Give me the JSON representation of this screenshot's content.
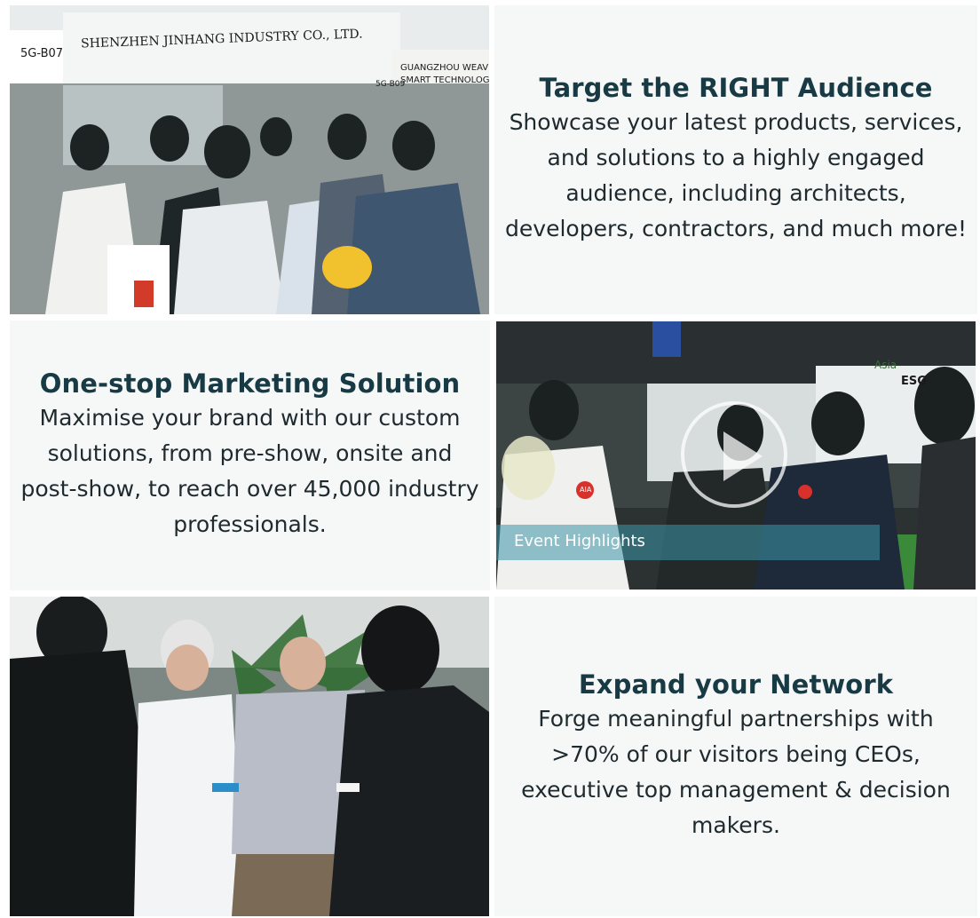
{
  "blocks": [
    {
      "title": "Target the RIGHT Audience",
      "lines": [
        "Showcase your latest products, services,",
        "and solutions to a highly engaged",
        "audience, including architects,",
        "developers, contractors, and much more!"
      ]
    },
    {
      "title": "One-stop Marketing Solution",
      "lines": [
        "Maximise your brand with our custom",
        "solutions, from pre-show, onsite and",
        "post-show, to reach over 45,000 industry",
        "professionals."
      ]
    },
    {
      "title": "Expand your Network",
      "lines": [
        "Forge meaningful partnerships with",
        ">70% of our visitors being CEOs,",
        "executive top management & decision",
        "makers."
      ]
    }
  ],
  "photo1_signs": {
    "booth_left": "5G-B07",
    "company_left": "SHENZHEN JINHANG INDUSTRY CO., LTD.",
    "booth_right": "5G-B09",
    "company_right_1": "GUANGZHOU WEAVING",
    "company_right_2": "SMART TECHNOLOGY C"
  },
  "video": {
    "caption": "Event Highlights",
    "sign_text": "ESG",
    "logo_text": "Asia",
    "badge_text": "AIA"
  },
  "colors": {
    "title": "#173a45",
    "panel_bg": "#f6f7f7",
    "caption_bar": "#3c96aa"
  }
}
